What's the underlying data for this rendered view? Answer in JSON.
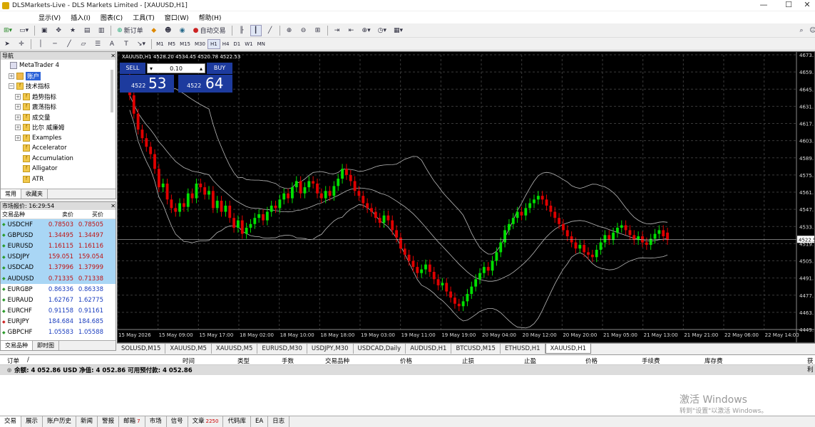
{
  "window": {
    "title": "DLSMarkets-Live - DLS Markets Limited - [XAUUSD,H1]",
    "controls": [
      "—",
      "☐",
      "✕"
    ]
  },
  "menu": [
    "显示(V)",
    "插入(I)",
    "图表(C)",
    "工具(T)",
    "窗口(W)",
    "帮助(H)"
  ],
  "toolbar": {
    "new_order": "新订单",
    "auto_trade": "自动交易",
    "timeframes": [
      "M1",
      "M5",
      "M15",
      "M30",
      "H1",
      "H4",
      "D1",
      "W1",
      "MN"
    ],
    "current_tf": "H1"
  },
  "navigator": {
    "title": "导航",
    "items": [
      {
        "label": "MetaTrader 4",
        "level": 0,
        "box": "",
        "icon": "mt4"
      },
      {
        "label": "账户",
        "level": 1,
        "box": "+",
        "icon": "accounts",
        "selected": true
      },
      {
        "label": "技术指标",
        "level": 1,
        "box": "−",
        "icon": "folder"
      },
      {
        "label": "趋势指标",
        "level": 2,
        "box": "+",
        "icon": "folder"
      },
      {
        "label": "震荡指标",
        "level": 2,
        "box": "+",
        "icon": "folder"
      },
      {
        "label": "成交量",
        "level": 2,
        "box": "+",
        "icon": "folder"
      },
      {
        "label": "比尔 威廉姆",
        "level": 2,
        "box": "+",
        "icon": "folder"
      },
      {
        "label": "Examples",
        "level": 2,
        "box": "+",
        "icon": "folder"
      },
      {
        "label": "Accelerator",
        "level": 2,
        "box": "",
        "icon": "indicator"
      },
      {
        "label": "Accumulation",
        "level": 2,
        "box": "",
        "icon": "indicator"
      },
      {
        "label": "Alligator",
        "level": 2,
        "box": "",
        "icon": "indicator"
      },
      {
        "label": "ATR",
        "level": 2,
        "box": "",
        "icon": "indicator"
      }
    ],
    "tabs": [
      "常用",
      "收藏夹"
    ]
  },
  "market_watch": {
    "title": "市场报价: 16:29:54",
    "columns": [
      "交易品种",
      "卖价",
      "买价"
    ],
    "rows": [
      {
        "symbol": "USDCHF",
        "bid": "0.78503",
        "ask": "0.78505",
        "dir": "up",
        "hl": true
      },
      {
        "symbol": "GBPUSD",
        "bid": "1.34495",
        "ask": "1.34497",
        "dir": "up",
        "hl": true
      },
      {
        "symbol": "EURUSD",
        "bid": "1.16115",
        "ask": "1.16116",
        "dir": "up",
        "hl": true
      },
      {
        "symbol": "USDJPY",
        "bid": "159.051",
        "ask": "159.054",
        "dir": "up",
        "hl": true
      },
      {
        "symbol": "USDCAD",
        "bid": "1.37996",
        "ask": "1.37999",
        "dir": "up",
        "hl": true
      },
      {
        "symbol": "AUDUSD",
        "bid": "0.71335",
        "ask": "0.71338",
        "dir": "up",
        "hl": true
      },
      {
        "symbol": "EURGBP",
        "bid": "0.86336",
        "ask": "0.86338",
        "dir": "up",
        "hl": false
      },
      {
        "symbol": "EURAUD",
        "bid": "1.62767",
        "ask": "1.62775",
        "dir": "up",
        "hl": false
      },
      {
        "symbol": "EURCHF",
        "bid": "0.91158",
        "ask": "0.91161",
        "dir": "up",
        "hl": false
      },
      {
        "symbol": "EURJPY",
        "bid": "184.684",
        "ask": "184.685",
        "dir": "down",
        "hl": false
      },
      {
        "symbol": "GBPCHF",
        "bid": "1.05583",
        "ask": "1.05588",
        "dir": "up",
        "hl": false
      }
    ],
    "tabs": [
      "交易品种",
      "即时图"
    ]
  },
  "chart": {
    "header": "XAUUSD,H1  4528.20 4534.45 4520.78 4522.53",
    "sell_label": "SELL",
    "buy_label": "BUY",
    "lot": "0.10",
    "sell_small": "4522",
    "sell_big": "53",
    "buy_small": "4522",
    "buy_big": "64",
    "colors": {
      "up": "#00e000",
      "down": "#e00000",
      "bands": "#b8b8b8",
      "grid": "#3a3a3a"
    }
  },
  "chart_data": {
    "type": "candlestick",
    "title": "XAUUSD,H1",
    "y_ticks": [
      "4673.",
      "4659.",
      "4645.",
      "4631.",
      "4617.",
      "4603.",
      "4589.",
      "4575.",
      "4561.",
      "4547.",
      "4533.",
      "4519.",
      "4505.",
      "4491.",
      "4477.",
      "4463.",
      "4449."
    ],
    "ylim": [
      4449,
      4673
    ],
    "current_price": "4522.53",
    "x_ticks": [
      "15 May 2026",
      "15 May 09:00",
      "15 May 17:00",
      "18 May 02:00",
      "18 May 10:00",
      "18 May 18:00",
      "19 May 03:00",
      "19 May 11:00",
      "19 May 19:00",
      "20 May 04:00",
      "20 May 12:00",
      "20 May 20:00",
      "21 May 05:00",
      "21 May 13:00",
      "21 May 21:00",
      "22 May 06:00",
      "22 May 14:00"
    ],
    "closes": [
      4640,
      4625,
      4612,
      4605,
      4598,
      4592,
      4580,
      4565,
      4568,
      4555,
      4548,
      4545,
      4552,
      4549,
      4560,
      4556,
      4568,
      4565,
      4559,
      4562,
      4548,
      4554,
      4545,
      4550,
      4540,
      4532,
      4538,
      4527,
      4532,
      4535,
      4540,
      4543,
      4538,
      4545,
      4550,
      4548,
      4555,
      4560,
      4556,
      4565,
      4570,
      4560,
      4565,
      4570,
      4568,
      4560,
      4556,
      4562,
      4558,
      4566,
      4572,
      4580,
      4575,
      4570,
      4562,
      4558,
      4552,
      4548,
      4545,
      4540,
      4536,
      4542,
      4538,
      4530,
      4524,
      4515,
      4510,
      4505,
      4500,
      4495,
      4498,
      4502,
      4496,
      4490,
      4485,
      4487,
      4480,
      4475,
      4470,
      4468,
      4472,
      4478,
      4484,
      4490,
      4495,
      4500,
      4497,
      4505,
      4512,
      4520,
      4530,
      4535,
      4540,
      4545,
      4542,
      4548,
      4552,
      4555,
      4558,
      4555,
      4550,
      4545,
      4540,
      4535,
      4530,
      4525,
      4520,
      4515,
      4518,
      4512,
      4510,
      4508,
      4514,
      4520,
      4526,
      4522,
      4528,
      4532,
      4534,
      4530,
      4526,
      4522,
      4525,
      4520,
      4518,
      4523,
      4527,
      4530,
      4525,
      4522
    ],
    "opens": [
      4655,
      4640,
      4625,
      4612,
      4605,
      4598,
      4592,
      4580,
      4565,
      4568,
      4555,
      4548,
      4545,
      4552,
      4549,
      4560,
      4556,
      4568,
      4565,
      4559,
      4562,
      4548,
      4554,
      4545,
      4550,
      4540,
      4532,
      4538,
      4527,
      4532,
      4535,
      4540,
      4543,
      4538,
      4545,
      4550,
      4548,
      4555,
      4560,
      4556,
      4565,
      4570,
      4560,
      4565,
      4570,
      4568,
      4560,
      4556,
      4562,
      4558,
      4566,
      4572,
      4580,
      4575,
      4570,
      4562,
      4558,
      4552,
      4548,
      4545,
      4540,
      4536,
      4542,
      4538,
      4530,
      4524,
      4515,
      4510,
      4505,
      4500,
      4495,
      4498,
      4502,
      4496,
      4490,
      4485,
      4487,
      4480,
      4475,
      4470,
      4468,
      4472,
      4478,
      4484,
      4490,
      4495,
      4500,
      4497,
      4505,
      4512,
      4520,
      4530,
      4535,
      4540,
      4545,
      4542,
      4548,
      4552,
      4555,
      4558,
      4555,
      4550,
      4545,
      4540,
      4535,
      4530,
      4525,
      4520,
      4515,
      4518,
      4512,
      4510,
      4508,
      4514,
      4520,
      4526,
      4522,
      4528,
      4532,
      4534,
      4530,
      4526,
      4522,
      4525,
      4520,
      4518,
      4523,
      4527,
      4530,
      4528
    ]
  },
  "chart_tabs": [
    "SOLUSD,M15",
    "XAUUSD,M5",
    "XAUUSD,M5",
    "EURUSD,M30",
    "USDJPY,M30",
    "USDCAD,Daily",
    "AUDUSD,H1",
    "BTCUSD,M15",
    "ETHUSD,H1",
    "XAUUSD,H1"
  ],
  "chart_tab_active": "XAUUSD,H1",
  "terminal": {
    "columns": [
      "订单",
      "/",
      "时间",
      "类型",
      "手数",
      "交易品种",
      "价格",
      "止损",
      "止盈",
      "价格",
      "手续费",
      "库存费",
      "获利"
    ],
    "balance": "余额: 4 052.86 USD  净值: 4 052.86  可用预付款: 4 052.86",
    "tabs": [
      {
        "label": "交易",
        "badge": ""
      },
      {
        "label": "展示",
        "badge": ""
      },
      {
        "label": "账户历史",
        "badge": ""
      },
      {
        "label": "新闻",
        "badge": ""
      },
      {
        "label": "警报",
        "badge": ""
      },
      {
        "label": "邮箱",
        "badge": "7"
      },
      {
        "label": "市场",
        "badge": ""
      },
      {
        "label": "信号",
        "badge": ""
      },
      {
        "label": "文章",
        "badge": "2250"
      },
      {
        "label": "代码库",
        "badge": ""
      },
      {
        "label": "EA",
        "badge": ""
      },
      {
        "label": "日志",
        "badge": ""
      }
    ],
    "active_tab": "交易"
  },
  "activation": {
    "line1": "激活 Windows",
    "line2": "转到\"设置\"以激活 Windows。"
  }
}
